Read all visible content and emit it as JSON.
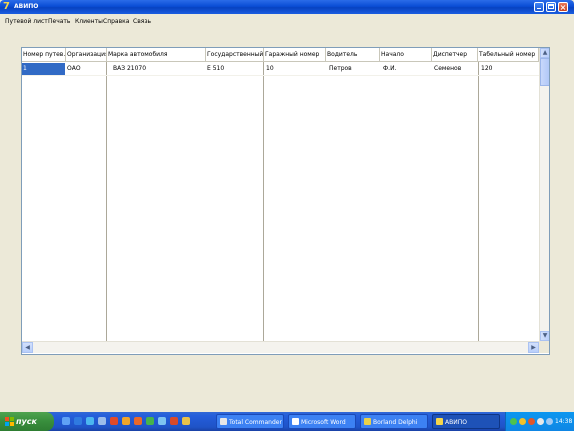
{
  "window": {
    "title": "АВИПО"
  },
  "menu": [
    "Путевой лист",
    "Печать",
    "Клиенты",
    "Справка",
    "Связь"
  ],
  "grid": {
    "columns": [
      "Номер путев.",
      "Организация",
      "Марка автомобиля",
      "Государственный номер",
      "Гаражный номер",
      "Водитель",
      "Начало",
      "Диспетчер",
      "Табельный номер"
    ],
    "rows": [
      [
        "1",
        "ОАО",
        "ВАЗ 21070",
        "Е 510",
        "10",
        "Петров",
        "Ф.И.",
        "Семенов",
        "120"
      ]
    ],
    "selected_row": 0,
    "selection_color": "#316ac5"
  },
  "taskbar": {
    "start_label": "пуск",
    "tasks": [
      {
        "label": "Total Commander",
        "active": false
      },
      {
        "label": "Microsoft Word",
        "active": false
      },
      {
        "label": "Borland Delphi",
        "active": false
      },
      {
        "label": "АВИПО",
        "active": true
      }
    ],
    "clock": "14:38"
  },
  "colors": {
    "titlebar": "#0a4dd6",
    "window_bg": "#ece9d8",
    "taskbar": "#245edb",
    "start": "#388e3c"
  }
}
